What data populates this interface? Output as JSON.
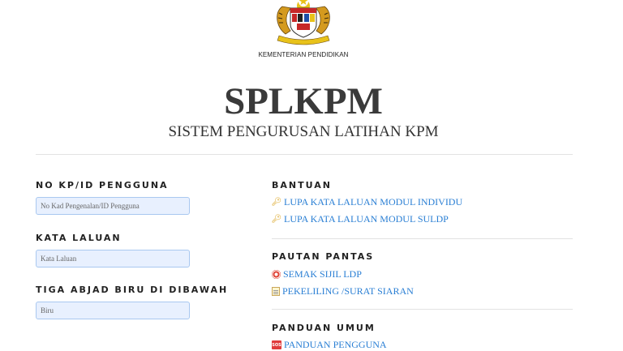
{
  "header": {
    "ministry": "KEMENTERIAN PENDIDIKAN",
    "title": "SPLKPM",
    "subtitle": "SISTEM PENGURUSAN LATIHAN KPM"
  },
  "login": {
    "id_label": "NO KP/ID PENGGUNA",
    "id_placeholder": "No Kad Pengenalan/ID Pengguna",
    "password_label": "KATA LALUAN",
    "password_placeholder": "Kata Laluan",
    "captcha_label": "TIGA ABJAD BIRU DI DIBAWAH",
    "captcha_placeholder": "Biru"
  },
  "bantuan": {
    "heading": "BANTUAN",
    "links": [
      "LUPA KATA LALUAN MODUL INDIVIDU",
      "LUPA KATA LALUAN MODUL SULDP"
    ]
  },
  "pautan": {
    "heading": "PAUTAN PANTAS",
    "links": [
      "SEMAK SIJIL LDP",
      "PEKELILING /SURAT SIARAN"
    ]
  },
  "panduan": {
    "heading": "PANDUAN UMUM",
    "links": [
      "PANDUAN PENGGUNA"
    ]
  },
  "icons": {
    "bantuan": "key-icon",
    "semak": "target-icon",
    "pekeliling": "memo-icon",
    "panduan": "sos-icon"
  }
}
